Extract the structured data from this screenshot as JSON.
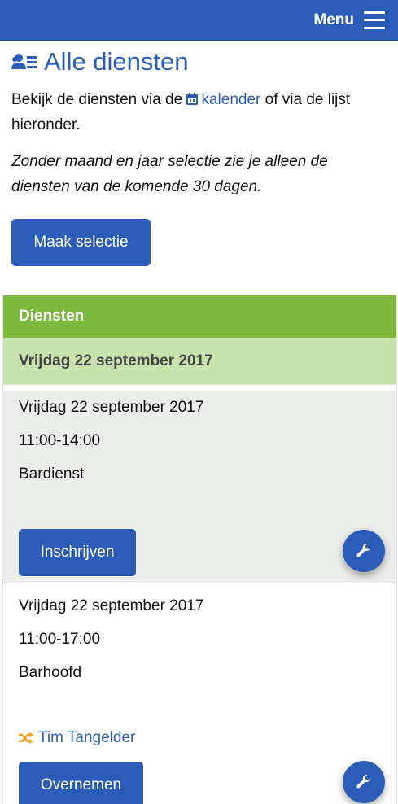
{
  "header": {
    "menu_label": "Menu",
    "brand_color": "#2b5cb8"
  },
  "page": {
    "title": "Alle diensten",
    "title_icon": "users-icon",
    "intro_before": "Bekijk de diensten via de",
    "intro_link": "kalender",
    "intro_after": "of via de lijst hieronder.",
    "note": "Zonder maand en jaar selectie zie je alleen de diensten van de komende 30 dagen.",
    "select_button": "Maak selectie"
  },
  "panel": {
    "header": "Diensten",
    "header_color": "#7cb93c",
    "day": "Vrijdag 22 september 2017",
    "shifts": [
      {
        "date": "Vrijdag 22 september 2017",
        "time": "11:00-14:00",
        "role": "Bardienst",
        "action": "Inschrijven",
        "action_icon": "wrench-icon"
      },
      {
        "date": "Vrijdag 22 september 2017",
        "time": "11:00-17:00",
        "role": "Barhoofd",
        "person": "Tim Tangelder",
        "person_icon": "shuffle-icon",
        "action": "Overnemen",
        "action_icon": "wrench-icon"
      }
    ]
  }
}
